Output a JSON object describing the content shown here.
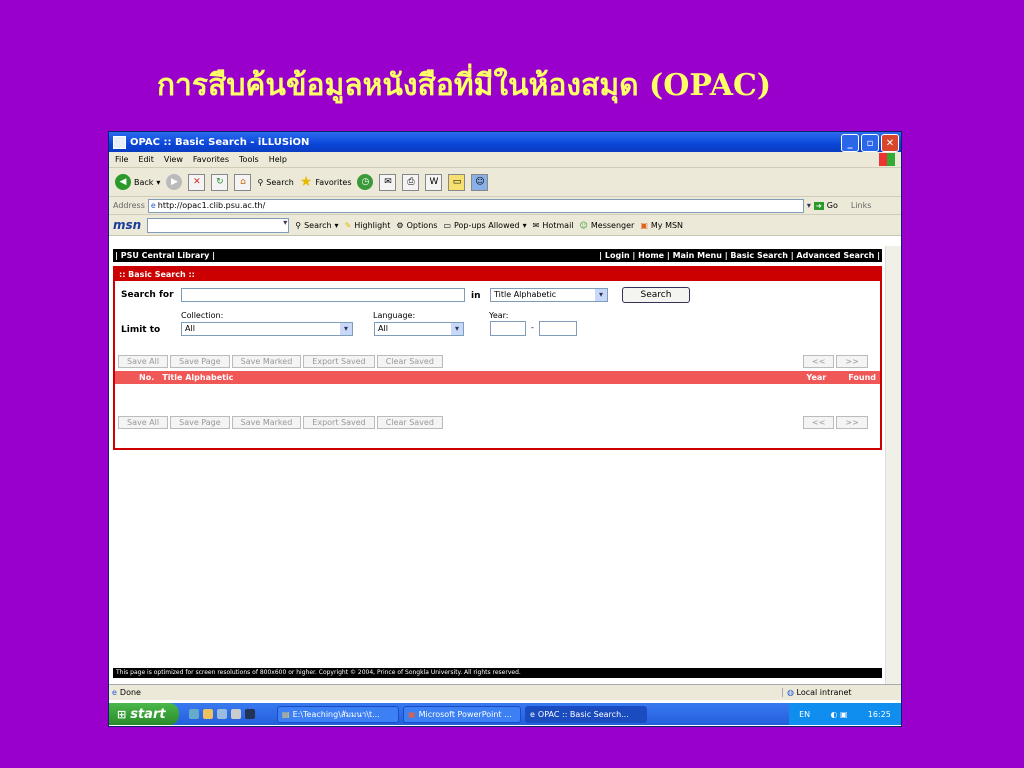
{
  "slide": {
    "title": "การสืบค้นข้อมูลหนังสือที่มีในห้องสมุด (OPAC)"
  },
  "window": {
    "title": "OPAC :: Basic Search - iLLUSiON"
  },
  "menubar": {
    "items": [
      "File",
      "Edit",
      "View",
      "Favorites",
      "Tools",
      "Help"
    ]
  },
  "toolbar": {
    "back": "Back",
    "search": "Search",
    "favorites": "Favorites"
  },
  "address": {
    "label": "Address",
    "url": "http://opac1.clib.psu.ac.th/",
    "go": "Go",
    "links": "Links"
  },
  "msnbar": {
    "logo": "msn",
    "search": "Search",
    "highlight": "Highlight",
    "options": "Options",
    "popups": "Pop-ups Allowed",
    "hotmail": "Hotmail",
    "messenger": "Messenger",
    "mymsn": "My MSN"
  },
  "nav": {
    "library": "| PSU Central Library |",
    "links": "| Login | Home | Main Menu | Basic Search | Advanced Search |"
  },
  "panel": {
    "title": ":: Basic Search ::",
    "search_for": "Search for",
    "in_label": "in",
    "search_type": "Title Alphabetic",
    "search_button": "Search",
    "limit_to": "Limit to",
    "collection_label": "Collection:",
    "collection_value": "All",
    "language_label": "Language:",
    "language_value": "All",
    "year_label": "Year:",
    "year_sep": "-",
    "buttons": [
      "Save All",
      "Save Page",
      "Save Marked",
      "Export Saved",
      "Clear Saved"
    ],
    "prev": "<<",
    "next": ">>",
    "columns": {
      "no": "No.",
      "title": "Title Alphabetic",
      "year": "Year",
      "found": "Found"
    }
  },
  "footer": "This page is optimized for screen resolutions of 800x600 or higher. Copyright © 2004, Prince of Songkla University. All rights reserved.",
  "status": {
    "done": "Done",
    "zone": "Local intranet"
  },
  "taskbar": {
    "start": "start",
    "tasks": [
      "E:\\Teaching\\สัมมนา\\t...",
      "Microsoft PowerPoint ...",
      "OPAC :: Basic Search..."
    ],
    "lang": "EN",
    "clock": "16:25"
  }
}
